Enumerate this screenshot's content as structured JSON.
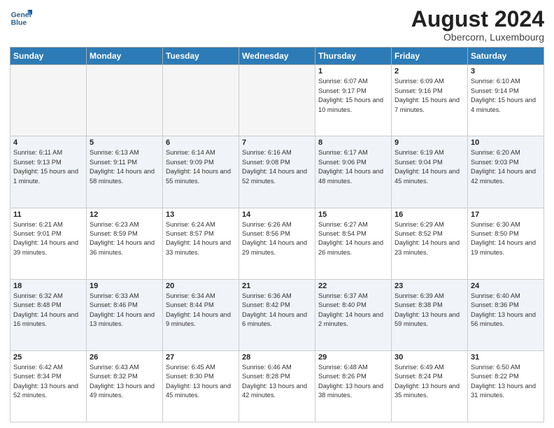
{
  "logo": {
    "text_general": "General",
    "text_blue": "Blue"
  },
  "title": "August 2024",
  "location": "Obercorn, Luxembourg",
  "weekdays": [
    "Sunday",
    "Monday",
    "Tuesday",
    "Wednesday",
    "Thursday",
    "Friday",
    "Saturday"
  ],
  "weeks": [
    [
      {
        "day": "",
        "empty": true
      },
      {
        "day": "",
        "empty": true
      },
      {
        "day": "",
        "empty": true
      },
      {
        "day": "",
        "empty": true
      },
      {
        "day": "1",
        "sunrise": "6:07 AM",
        "sunset": "9:17 PM",
        "daylight": "15 hours and 10 minutes."
      },
      {
        "day": "2",
        "sunrise": "6:09 AM",
        "sunset": "9:16 PM",
        "daylight": "15 hours and 7 minutes."
      },
      {
        "day": "3",
        "sunrise": "6:10 AM",
        "sunset": "9:14 PM",
        "daylight": "15 hours and 4 minutes."
      }
    ],
    [
      {
        "day": "4",
        "sunrise": "6:11 AM",
        "sunset": "9:13 PM",
        "daylight": "15 hours and 1 minute."
      },
      {
        "day": "5",
        "sunrise": "6:13 AM",
        "sunset": "9:11 PM",
        "daylight": "14 hours and 58 minutes."
      },
      {
        "day": "6",
        "sunrise": "6:14 AM",
        "sunset": "9:09 PM",
        "daylight": "14 hours and 55 minutes."
      },
      {
        "day": "7",
        "sunrise": "6:16 AM",
        "sunset": "9:08 PM",
        "daylight": "14 hours and 52 minutes."
      },
      {
        "day": "8",
        "sunrise": "6:17 AM",
        "sunset": "9:06 PM",
        "daylight": "14 hours and 48 minutes."
      },
      {
        "day": "9",
        "sunrise": "6:19 AM",
        "sunset": "9:04 PM",
        "daylight": "14 hours and 45 minutes."
      },
      {
        "day": "10",
        "sunrise": "6:20 AM",
        "sunset": "9:03 PM",
        "daylight": "14 hours and 42 minutes."
      }
    ],
    [
      {
        "day": "11",
        "sunrise": "6:21 AM",
        "sunset": "9:01 PM",
        "daylight": "14 hours and 39 minutes."
      },
      {
        "day": "12",
        "sunrise": "6:23 AM",
        "sunset": "8:59 PM",
        "daylight": "14 hours and 36 minutes."
      },
      {
        "day": "13",
        "sunrise": "6:24 AM",
        "sunset": "8:57 PM",
        "daylight": "14 hours and 33 minutes."
      },
      {
        "day": "14",
        "sunrise": "6:26 AM",
        "sunset": "8:56 PM",
        "daylight": "14 hours and 29 minutes."
      },
      {
        "day": "15",
        "sunrise": "6:27 AM",
        "sunset": "8:54 PM",
        "daylight": "14 hours and 26 minutes."
      },
      {
        "day": "16",
        "sunrise": "6:29 AM",
        "sunset": "8:52 PM",
        "daylight": "14 hours and 23 minutes."
      },
      {
        "day": "17",
        "sunrise": "6:30 AM",
        "sunset": "8:50 PM",
        "daylight": "14 hours and 19 minutes."
      }
    ],
    [
      {
        "day": "18",
        "sunrise": "6:32 AM",
        "sunset": "8:48 PM",
        "daylight": "14 hours and 16 minutes."
      },
      {
        "day": "19",
        "sunrise": "6:33 AM",
        "sunset": "8:46 PM",
        "daylight": "14 hours and 13 minutes."
      },
      {
        "day": "20",
        "sunrise": "6:34 AM",
        "sunset": "8:44 PM",
        "daylight": "14 hours and 9 minutes."
      },
      {
        "day": "21",
        "sunrise": "6:36 AM",
        "sunset": "8:42 PM",
        "daylight": "14 hours and 6 minutes."
      },
      {
        "day": "22",
        "sunrise": "6:37 AM",
        "sunset": "8:40 PM",
        "daylight": "14 hours and 2 minutes."
      },
      {
        "day": "23",
        "sunrise": "6:39 AM",
        "sunset": "8:38 PM",
        "daylight": "13 hours and 59 minutes."
      },
      {
        "day": "24",
        "sunrise": "6:40 AM",
        "sunset": "8:36 PM",
        "daylight": "13 hours and 56 minutes."
      }
    ],
    [
      {
        "day": "25",
        "sunrise": "6:42 AM",
        "sunset": "8:34 PM",
        "daylight": "13 hours and 52 minutes."
      },
      {
        "day": "26",
        "sunrise": "6:43 AM",
        "sunset": "8:32 PM",
        "daylight": "13 hours and 49 minutes."
      },
      {
        "day": "27",
        "sunrise": "6:45 AM",
        "sunset": "8:30 PM",
        "daylight": "13 hours and 45 minutes."
      },
      {
        "day": "28",
        "sunrise": "6:46 AM",
        "sunset": "8:28 PM",
        "daylight": "13 hours and 42 minutes."
      },
      {
        "day": "29",
        "sunrise": "6:48 AM",
        "sunset": "8:26 PM",
        "daylight": "13 hours and 38 minutes."
      },
      {
        "day": "30",
        "sunrise": "6:49 AM",
        "sunset": "8:24 PM",
        "daylight": "13 hours and 35 minutes."
      },
      {
        "day": "31",
        "sunrise": "6:50 AM",
        "sunset": "8:22 PM",
        "daylight": "13 hours and 31 minutes."
      }
    ]
  ]
}
